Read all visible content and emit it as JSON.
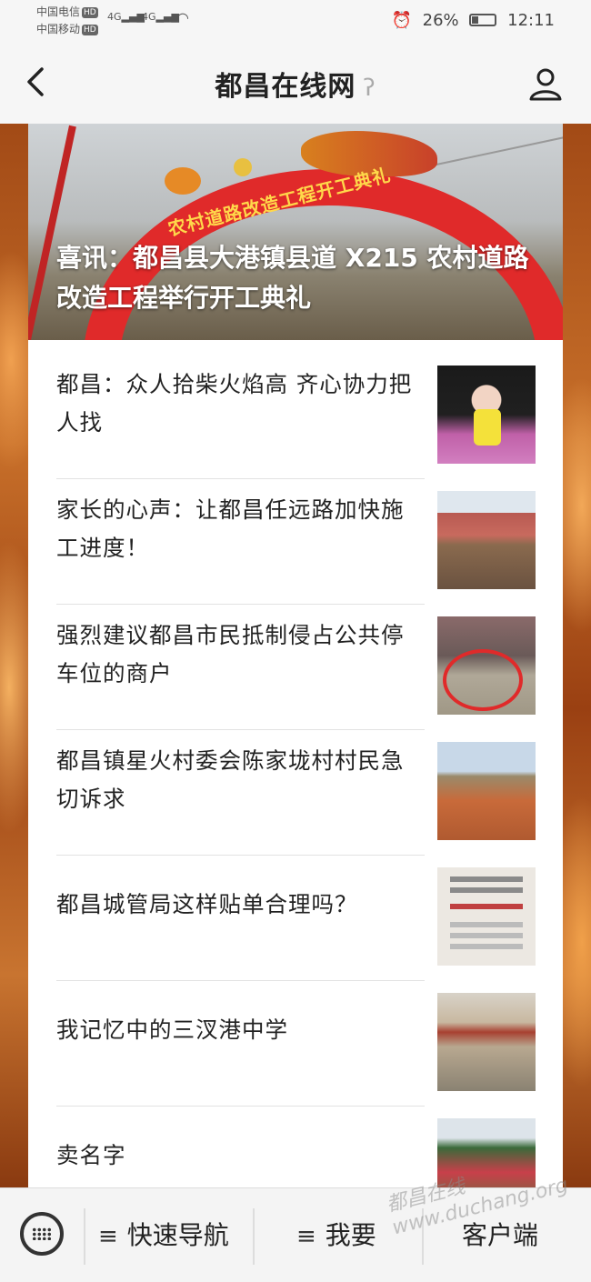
{
  "status_bar": {
    "carrier1": "中国电信",
    "carrier2": "中国移动",
    "hd": "HD",
    "net": "4G",
    "battery_percent": "26%",
    "time": "12:11"
  },
  "header": {
    "title": "都昌在线网"
  },
  "hero": {
    "arch_text": "农村道路改造工程开工典礼",
    "title": "喜讯：都昌县大港镇县道 X215 农村道路改造工程举行开工典礼"
  },
  "articles": [
    {
      "title": "都昌：众人拾柴火焰高  齐心协力把人找"
    },
    {
      "title": "家长的心声：让都昌任远路加快施工进度！"
    },
    {
      "title": "强烈建议都昌市民抵制侵占公共停车位的商户"
    },
    {
      "title": "都昌镇星火村委会陈家垅村村民急切诉求"
    },
    {
      "title": "都昌城管局这样贴单合理吗？"
    },
    {
      "title": "我记忆中的三汊港中学"
    },
    {
      "title": "卖名字"
    }
  ],
  "bottom_nav": {
    "quick_nav": "快速导航",
    "want": "我要",
    "client": "客户端"
  },
  "watermark": "都昌在线 www.duchang.org"
}
